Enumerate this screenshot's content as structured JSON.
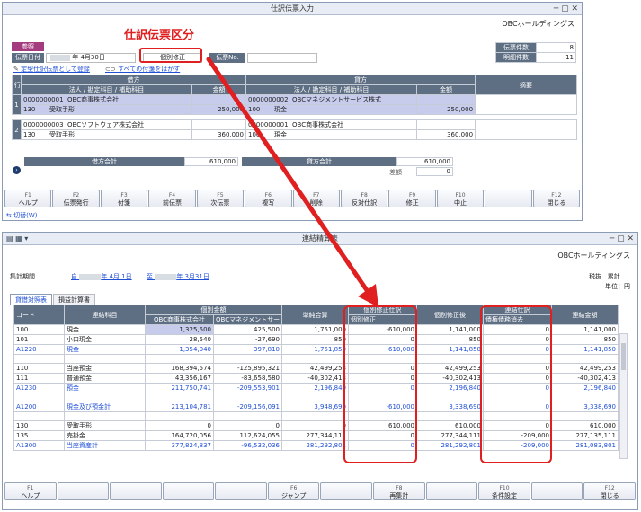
{
  "top": {
    "title": "仕訳伝票入力",
    "company": "OBCホールディングス",
    "ref_label": "参照",
    "date_label": "伝票日付",
    "date_value": "年 4月30日",
    "kubun_value": "個別修正",
    "denpyo_no_label": "伝票No.",
    "links": [
      "定型仕訳伝票として登録",
      "すべての付箋をはがす"
    ],
    "counts": [
      {
        "label": "伝票件数",
        "value": "8"
      },
      {
        "label": "明細件数",
        "value": "11"
      }
    ],
    "headers": {
      "row": "行",
      "debit": "借方",
      "credit": "貸方",
      "memo": "摘要",
      "sub": "法人 / 勘定科目 / 補助科目",
      "amount": "金額"
    },
    "rows": [
      {
        "no": "1",
        "d_code": "0000000001",
        "d_corp": "OBC商事株式会社",
        "d_acc_code": "130",
        "d_acc": "受取手形",
        "d_amt": "250,000",
        "c_code": "0000000002",
        "c_corp": "OBCマネジメントサービス株式",
        "c_acc_code": "100",
        "c_acc": "現金",
        "c_amt": "250,000"
      },
      {
        "no": "2",
        "d_code": "0000000003",
        "d_corp": "OBCソフトウェア株式会社",
        "d_acc_code": "130",
        "d_acc": "受取手形",
        "d_amt": "360,000",
        "c_code": "0000000001",
        "c_corp": "OBC商事株式会社",
        "c_acc_code": "100",
        "c_acc": "現金",
        "c_amt": "360,000"
      }
    ],
    "debit_total_label": "借方合計",
    "debit_total": "610,000",
    "credit_total_label": "貸方合計",
    "credit_total": "610,000",
    "diff_label": "差額",
    "diff_value": "0",
    "fkeys": [
      {
        "k": "F1",
        "l": "ヘルプ"
      },
      {
        "k": "F2",
        "l": "伝票発行"
      },
      {
        "k": "F3",
        "l": "付箋"
      },
      {
        "k": "F4",
        "l": "前伝票"
      },
      {
        "k": "F5",
        "l": "次伝票"
      },
      {
        "k": "F6",
        "l": "複写"
      },
      {
        "k": "F7",
        "l": "削除"
      },
      {
        "k": "F8",
        "l": "反対仕訳"
      },
      {
        "k": "F9",
        "l": "修正"
      },
      {
        "k": "F10",
        "l": "中止"
      },
      {
        "k": "",
        "l": ""
      },
      {
        "k": "F12",
        "l": "閉じる"
      }
    ],
    "switch_label": "切替(W)"
  },
  "annotation": "仕訳伝票区分",
  "bottom": {
    "title": "連結精算表",
    "company": "OBCホールディングス",
    "period_label": "集計期間",
    "period_from": "自",
    "period_from_date": "年 4月 1日",
    "period_to": "至",
    "period_to_date": "年 3月31日",
    "tax_label": "税抜",
    "sum_label": "累計",
    "unit_label": "単位：円",
    "tabs": [
      "貸借対照表",
      "損益計算書"
    ],
    "cols": {
      "code": "コード",
      "acc": "連結科目",
      "indiv": "個別金額",
      "corp1": "OBC商事株式会社",
      "corp2": "OBCマネジメントサー",
      "simple": "単純合算",
      "adj_head": "個別修正仕訳",
      "adj_sub": "個別修正",
      "after": "個別修正後",
      "cons_head": "連結仕訳",
      "cons_sub": "債権債務消去",
      "total": "連結金額"
    },
    "rows": [
      {
        "code": "100",
        "acc": "現金",
        "c1": "1,325,500",
        "c2": "425,500",
        "sum": "1,751,000",
        "adj": "-610,000",
        "after": "1,141,000",
        "cons": "0",
        "total": "1,141,000",
        "blue": false,
        "hl": true
      },
      {
        "code": "101",
        "acc": "小口現金",
        "c1": "28,540",
        "c2": "-27,690",
        "sum": "850",
        "adj": "0",
        "after": "850",
        "cons": "0",
        "total": "850",
        "blue": false,
        "hl": false
      },
      {
        "code": "A1220",
        "acc": "現金",
        "c1": "1,354,040",
        "c2": "397,810",
        "sum": "1,751,850",
        "adj": "-610,000",
        "after": "1,141,850",
        "cons": "0",
        "total": "1,141,850",
        "blue": true,
        "hl": false
      },
      {
        "code": "",
        "acc": "",
        "c1": "",
        "c2": "",
        "sum": "",
        "adj": "",
        "after": "",
        "cons": "",
        "total": "",
        "blue": false,
        "hl": false
      },
      {
        "code": "110",
        "acc": "当座預金",
        "c1": "168,394,574",
        "c2": "-125,895,321",
        "sum": "42,499,253",
        "adj": "0",
        "after": "42,499,253",
        "cons": "0",
        "total": "42,499,253",
        "blue": false,
        "hl": false
      },
      {
        "code": "111",
        "acc": "普通預金",
        "c1": "43,356,167",
        "c2": "-83,658,580",
        "sum": "-40,302,413",
        "adj": "0",
        "after": "-40,302,413",
        "cons": "0",
        "total": "-40,302,413",
        "blue": false,
        "hl": false
      },
      {
        "code": "A1230",
        "acc": "預金",
        "c1": "211,750,741",
        "c2": "-209,553,901",
        "sum": "2,196,840",
        "adj": "0",
        "after": "2,196,840",
        "cons": "0",
        "total": "2,196,840",
        "blue": true,
        "hl": false
      },
      {
        "code": "",
        "acc": "",
        "c1": "",
        "c2": "",
        "sum": "",
        "adj": "",
        "after": "",
        "cons": "",
        "total": "",
        "blue": false,
        "hl": false
      },
      {
        "code": "A1200",
        "acc": "現金及び預金計",
        "c1": "213,104,781",
        "c2": "-209,156,091",
        "sum": "3,948,690",
        "adj": "-610,000",
        "after": "3,338,690",
        "cons": "0",
        "total": "3,338,690",
        "blue": true,
        "hl": false
      },
      {
        "code": "",
        "acc": "",
        "c1": "",
        "c2": "",
        "sum": "",
        "adj": "",
        "after": "",
        "cons": "",
        "total": "",
        "blue": false,
        "hl": false
      },
      {
        "code": "130",
        "acc": "受取手形",
        "c1": "0",
        "c2": "0",
        "sum": "0",
        "adj": "610,000",
        "after": "610,000",
        "cons": "0",
        "total": "610,000",
        "blue": false,
        "hl": false
      },
      {
        "code": "135",
        "acc": "売掛金",
        "c1": "164,720,056",
        "c2": "112,624,055",
        "sum": "277,344,111",
        "adj": "0",
        "after": "277,344,111",
        "cons": "-209,000",
        "total": "277,135,111",
        "blue": false,
        "hl": false
      },
      {
        "code": "A1300",
        "acc": "当座資産計",
        "c1": "377,824,837",
        "c2": "-96,532,036",
        "sum": "281,292,801",
        "adj": "0",
        "after": "281,292,801",
        "cons": "-209,000",
        "total": "281,083,801",
        "blue": true,
        "hl": false
      }
    ],
    "fkeys": [
      {
        "k": "F1",
        "l": "ヘルプ"
      },
      {
        "k": "",
        "l": ""
      },
      {
        "k": "",
        "l": ""
      },
      {
        "k": "",
        "l": ""
      },
      {
        "k": "",
        "l": ""
      },
      {
        "k": "F6",
        "l": "ジャンプ"
      },
      {
        "k": "",
        "l": ""
      },
      {
        "k": "F8",
        "l": "再集計"
      },
      {
        "k": "",
        "l": ""
      },
      {
        "k": "F10",
        "l": "条件設定"
      },
      {
        "k": "",
        "l": ""
      },
      {
        "k": "F12",
        "l": "閉じる"
      }
    ]
  }
}
